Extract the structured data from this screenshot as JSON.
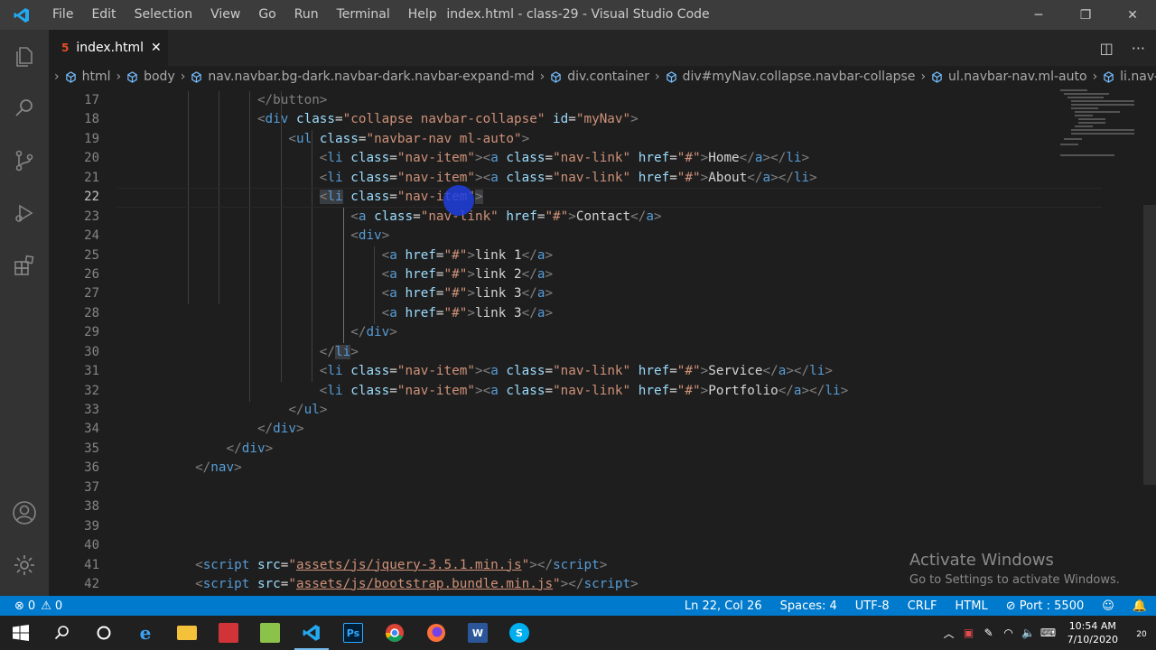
{
  "window": {
    "title": "index.html - class-29 - Visual Studio Code",
    "menu": [
      "File",
      "Edit",
      "Selection",
      "View",
      "Go",
      "Run",
      "Terminal",
      "Help"
    ],
    "controls": {
      "minimize": "─",
      "restore": "❐",
      "close": "✕"
    }
  },
  "tab": {
    "icon": "5",
    "label": "index.html",
    "close": "✕"
  },
  "editor_actions": {
    "split": "◫",
    "more": "···"
  },
  "breadcrumb": [
    "html",
    "body",
    "nav.navbar.bg-dark.navbar-dark.navbar-expand-md",
    "div.container",
    "div#myNav.collapse.navbar-collapse",
    "ul.navbar-nav.ml-auto",
    "li.nav-item"
  ],
  "line_numbers": [
    "17",
    "18",
    "19",
    "20",
    "21",
    "22",
    "23",
    "24",
    "25",
    "26",
    "27",
    "28",
    "29",
    "30",
    "31",
    "32",
    "33",
    "34",
    "35",
    "36",
    "37",
    "38",
    "39",
    "40",
    "41",
    "42"
  ],
  "active_line": "22",
  "code": {
    "l17": "</button>",
    "l18_tag": "div",
    "l18_attr1": "class",
    "l18_val1": "\"collapse navbar-collapse\"",
    "l18_attr2": "id",
    "l18_val2": "\"myNav\"",
    "l19_tag": "ul",
    "l19_attr": "class",
    "l19_val": "\"navbar-nav ml-auto\"",
    "item_class": "\"nav-item\"",
    "link_class": "\"nav-link\"",
    "href_val": "\"#\"",
    "home": "Home",
    "about": "About",
    "contact": "Contact",
    "link1": "link 1",
    "link2": "link 2",
    "link3": "link 3",
    "link3b": "link 3",
    "service": "Service",
    "portfolio": "Portfolio",
    "jquery_src": "assets/js/jquery-3.5.1.min.js",
    "bootstrap_src": "assets/js/bootstrap.bundle.min.js"
  },
  "watermark": {
    "title": "Activate Windows",
    "subtitle": "Go to Settings to activate Windows."
  },
  "status": {
    "errors": "0",
    "warnings": "0",
    "position": "Ln 22, Col 26",
    "spaces": "Spaces: 4",
    "encoding": "UTF-8",
    "eol": "CRLF",
    "language": "HTML",
    "port": "Port : 5500"
  },
  "taskbar": {
    "time": "10:54 AM",
    "date": "7/10/2020",
    "notifications": "20"
  },
  "colors": {
    "accent": "#007acc",
    "tag": "#569cd6",
    "attribute": "#9cdcfe",
    "string": "#ce9178",
    "text": "#d4d4d4"
  }
}
